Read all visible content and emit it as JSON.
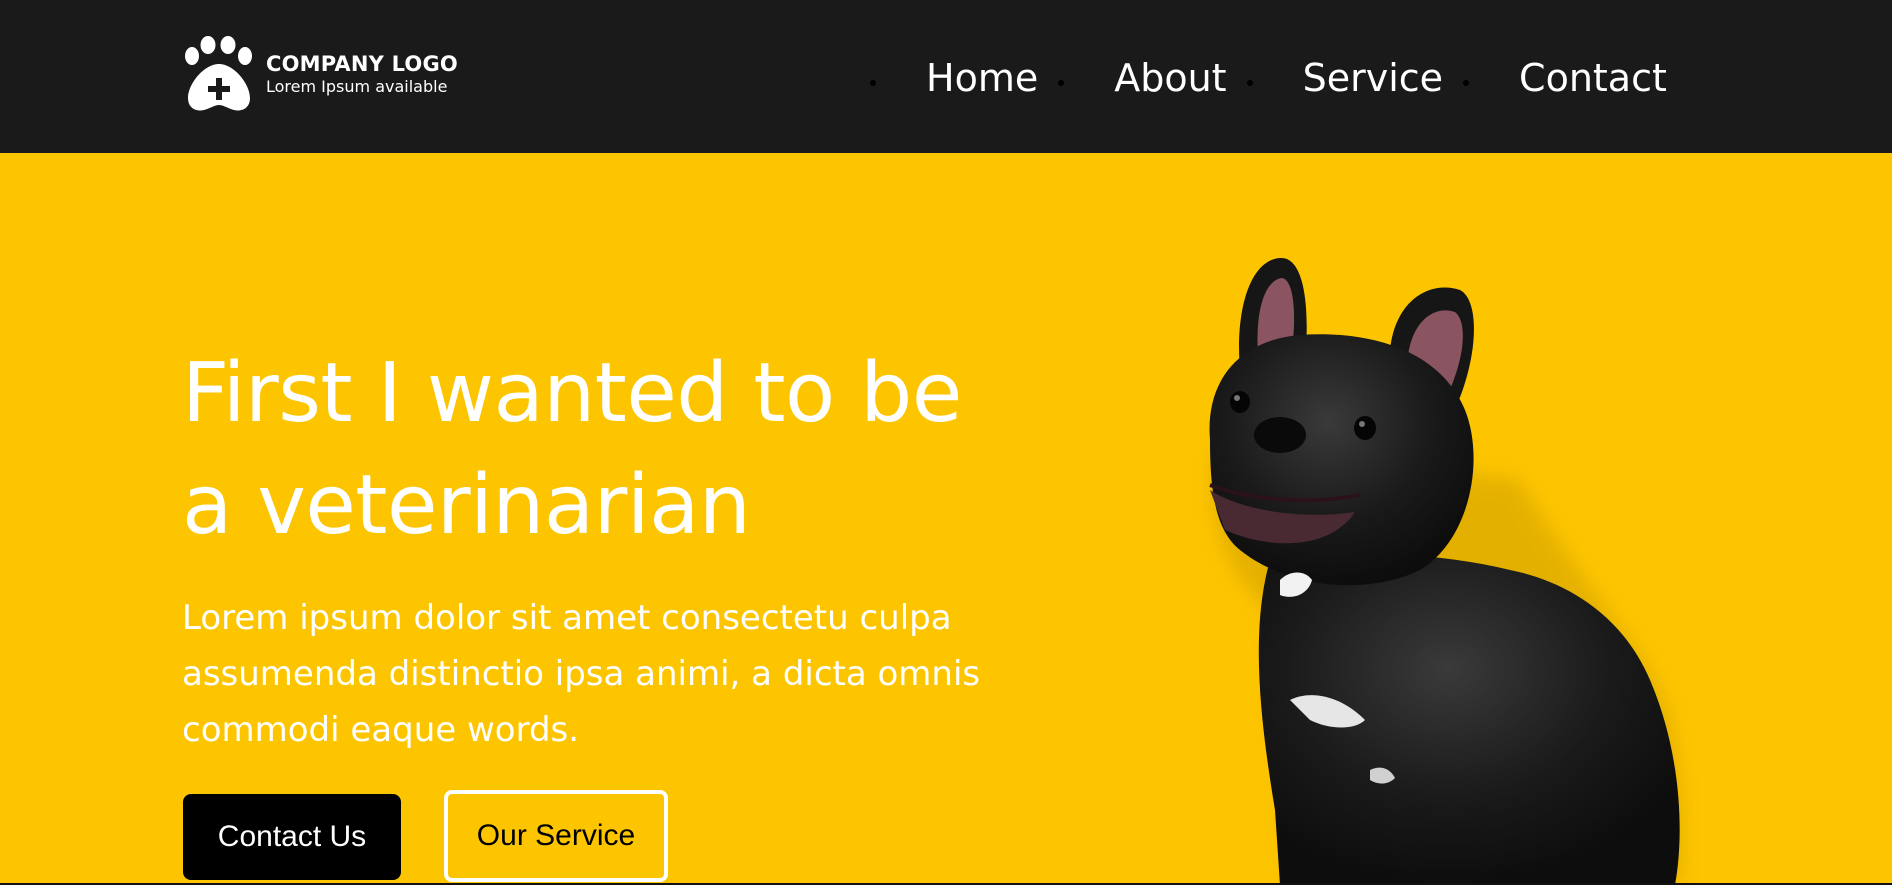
{
  "header": {
    "logo_title": "COMPANY LOGO",
    "logo_subtitle": "Lorem Ipsum available",
    "nav": [
      {
        "label": "Home"
      },
      {
        "label": "About"
      },
      {
        "label": "Service"
      },
      {
        "label": "Contact"
      }
    ]
  },
  "hero": {
    "title_line1": "First I wanted to be",
    "title_line2": "a veterinarian",
    "description": "Lorem ipsum dolor sit amet consectetu culpa assumenda distinctio ipsa animi, a dicta omnis commodi eaque words.",
    "primary_button": "Contact Us",
    "secondary_button": "Our Service"
  },
  "colors": {
    "navbar": "#1a1a1a",
    "hero_background": "#fdc500",
    "text": "#ffffff",
    "primary_button": "#000000"
  },
  "icons": {
    "logo": "paw-plus-icon",
    "hero_image": "french-bulldog-image"
  }
}
